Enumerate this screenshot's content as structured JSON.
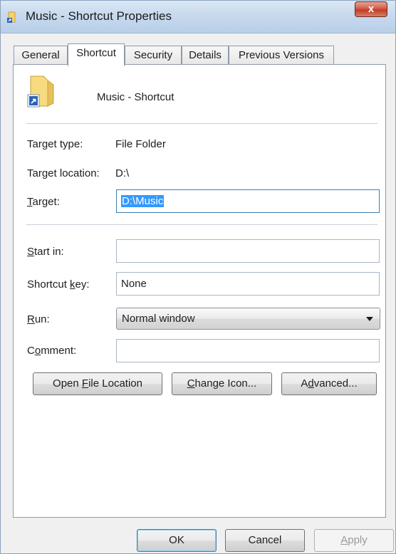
{
  "window": {
    "title": "Music - Shortcut Properties",
    "close_label": "x"
  },
  "tabs": [
    {
      "label": "General"
    },
    {
      "label": "Shortcut",
      "active": true
    },
    {
      "label": "Security"
    },
    {
      "label": "Details"
    },
    {
      "label": "Previous Versions"
    }
  ],
  "shortcut": {
    "name": "Music - Shortcut",
    "icon": "folder-shortcut-icon",
    "target_type_label": "Target type:",
    "target_type_value": "File Folder",
    "target_location_label": "Target location:",
    "target_location_value": "D:\\",
    "target_label_pre": "",
    "target_label_ul": "T",
    "target_label_post": "arget:",
    "target_value": "D:\\Music",
    "start_in_label_ul": "S",
    "start_in_label_post": "tart in:",
    "start_in_value": "",
    "shortcut_key_label_pre": "Shortcut ",
    "shortcut_key_label_ul": "k",
    "shortcut_key_label_post": "ey:",
    "shortcut_key_value": "None",
    "run_label_ul": "R",
    "run_label_post": "un:",
    "run_value": "Normal window",
    "comment_label_pre": "C",
    "comment_label_ul": "o",
    "comment_label_post": "mment:",
    "comment_value": ""
  },
  "actions": {
    "open_location_pre": "Open ",
    "open_location_ul": "F",
    "open_location_post": "ile Location",
    "change_icon_ul": "C",
    "change_icon_post": "hange Icon...",
    "advanced_pre": "A",
    "advanced_ul": "d",
    "advanced_post": "vanced..."
  },
  "footer": {
    "ok": "OK",
    "cancel": "Cancel",
    "apply_ul": "A",
    "apply_post": "pply"
  },
  "colors": {
    "selection": "#3399ff",
    "close_button": "#c13c24",
    "focus_border": "#3c7fb1"
  }
}
